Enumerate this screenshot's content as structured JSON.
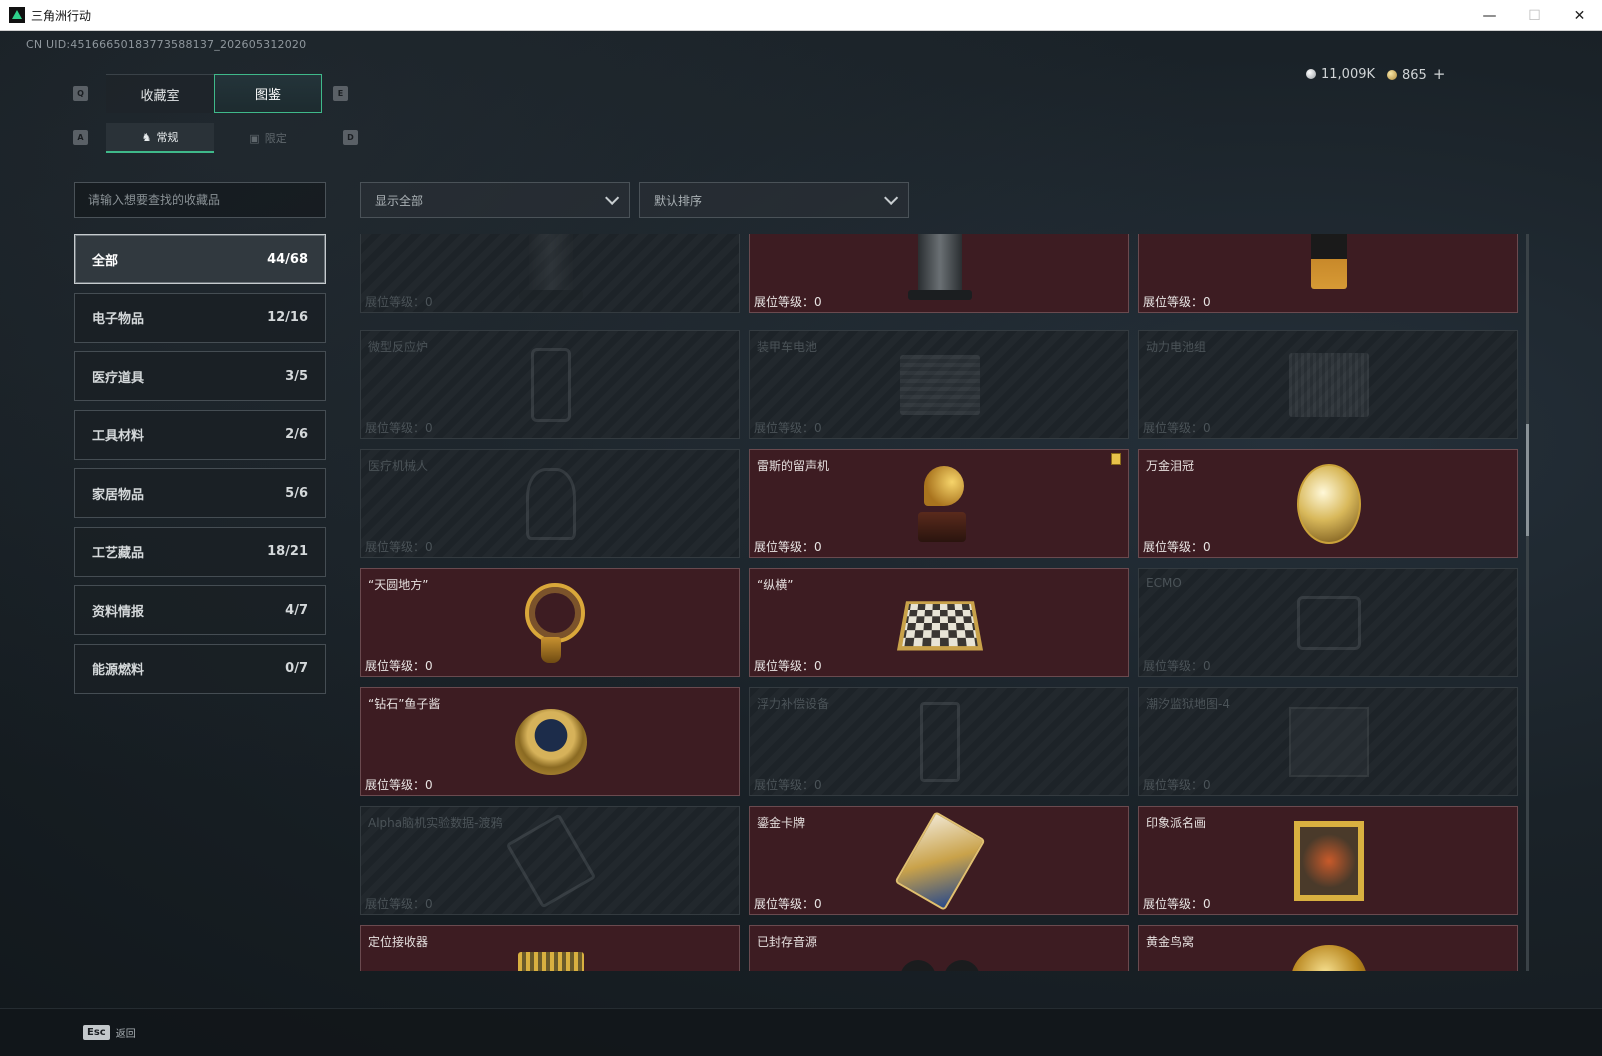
{
  "window": {
    "title": "三角洲行动",
    "minimize": "—",
    "maximize": "☐",
    "close": "✕"
  },
  "uid": "CN UID:4516665018377358813​7_202605312020",
  "currency": {
    "silver": "11,009K",
    "gold": "865",
    "add": "+"
  },
  "keys": {
    "q": "Q",
    "e": "E",
    "a": "A",
    "d": "D"
  },
  "tabs": [
    {
      "label": "收藏室"
    },
    {
      "label": "图鉴"
    }
  ],
  "subtabs": [
    {
      "label": "常规",
      "icon": "♞"
    },
    {
      "label": "限定",
      "icon": "▣"
    }
  ],
  "search": {
    "placeholder": "请输入想要查找的收藏品"
  },
  "filters": {
    "show": "显示全部",
    "sort": "默认排序"
  },
  "categories": [
    {
      "label": "全部",
      "count": "44/68"
    },
    {
      "label": "电子物品",
      "count": "12/16"
    },
    {
      "label": "医疗道具",
      "count": "3/5"
    },
    {
      "label": "工具材料",
      "count": "2/6"
    },
    {
      "label": "家居物品",
      "count": "5/6"
    },
    {
      "label": "工艺藏品",
      "count": "18/21"
    },
    {
      "label": "资料情报",
      "count": "4/7"
    },
    {
      "label": "能源燃料",
      "count": "0/7"
    }
  ],
  "level_label": "展位等级：",
  "items": [
    {
      "name": "",
      "level": "0",
      "owned": false,
      "art": "machine"
    },
    {
      "name": "",
      "level": "0",
      "owned": true,
      "art": "machine"
    },
    {
      "name": "",
      "level": "0",
      "owned": true,
      "art": "bag"
    },
    {
      "name": "微型反应炉",
      "level": "0",
      "owned": false,
      "art": "reactor"
    },
    {
      "name": "装甲车电池",
      "level": "0",
      "owned": false,
      "art": "battery"
    },
    {
      "name": "动力电池组",
      "level": "0",
      "owned": false,
      "art": "pack"
    },
    {
      "name": "医疗机械人",
      "level": "0",
      "owned": false,
      "art": "robot"
    },
    {
      "name": "雷斯的留声机",
      "level": "0",
      "owned": true,
      "art": "gramophone",
      "badge": true
    },
    {
      "name": "万金泪冠",
      "level": "0",
      "owned": true,
      "art": "egg"
    },
    {
      "name": "“天圆地方”",
      "level": "0",
      "owned": true,
      "art": "sphere"
    },
    {
      "name": "“纵横”",
      "level": "0",
      "owned": true,
      "art": "chess"
    },
    {
      "name": "ECMO",
      "level": "0",
      "owned": false,
      "art": "ecmo"
    },
    {
      "name": "“钻石”鱼子酱",
      "level": "0",
      "owned": true,
      "art": "caviar"
    },
    {
      "name": "浮力补偿设备",
      "level": "0",
      "owned": false,
      "art": "buoy"
    },
    {
      "name": "潮汐监狱地图-4",
      "level": "0",
      "owned": false,
      "art": "map"
    },
    {
      "name": "Alpha脑机实验数据-渡鸦",
      "level": "0",
      "owned": false,
      "art": "data"
    },
    {
      "name": "鎏金卡牌",
      "level": "0",
      "owned": true,
      "art": "card"
    },
    {
      "name": "印象派名画",
      "level": "0",
      "owned": true,
      "art": "painting"
    },
    {
      "name": "定位接收器",
      "level": "",
      "owned": true,
      "art": "receiver"
    },
    {
      "name": "已封存音源",
      "level": "",
      "owned": true,
      "art": "reels"
    },
    {
      "name": "黄金鸟窝",
      "level": "",
      "owned": true,
      "art": "nest"
    }
  ],
  "bottom": {
    "esc_key": "Esc",
    "back": "返回"
  }
}
